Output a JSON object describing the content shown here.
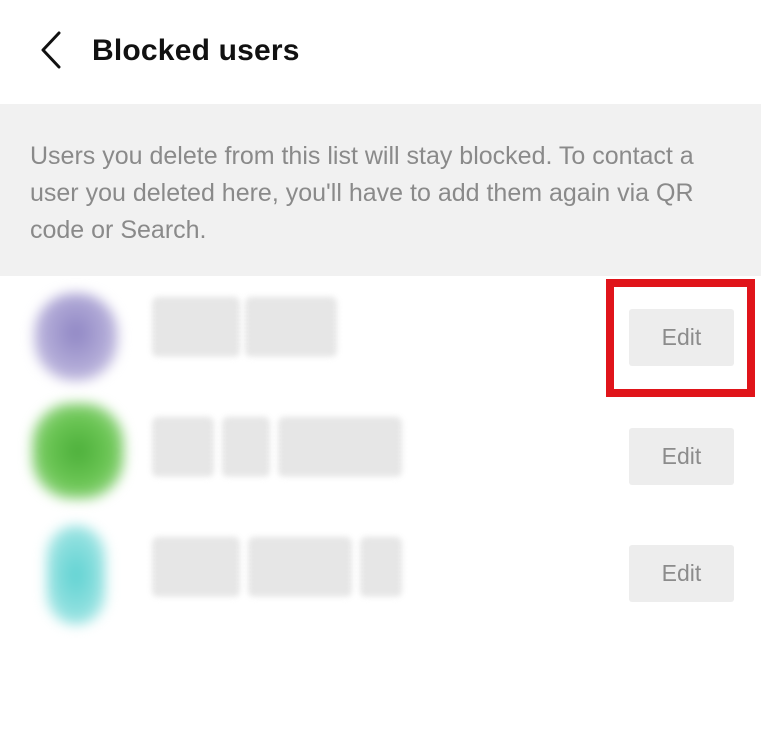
{
  "header": {
    "title": "Blocked users",
    "back_icon": "chevron-left-icon"
  },
  "info": {
    "text": "Users you delete from this list will stay blocked. To contact a user you deleted here, you'll have to add them again via QR code or Search."
  },
  "users": [
    {
      "edit_label": "Edit",
      "avatar_color": "#9a90c8",
      "highlighted": true
    },
    {
      "edit_label": "Edit",
      "avatar_color": "#5fbf4a",
      "highlighted": false
    },
    {
      "edit_label": "Edit",
      "avatar_color": "#6fd6d6",
      "highlighted": false
    }
  ],
  "colors": {
    "highlight": "#e0141a",
    "banner_bg": "#f1f1f1",
    "button_bg": "#ededed"
  }
}
